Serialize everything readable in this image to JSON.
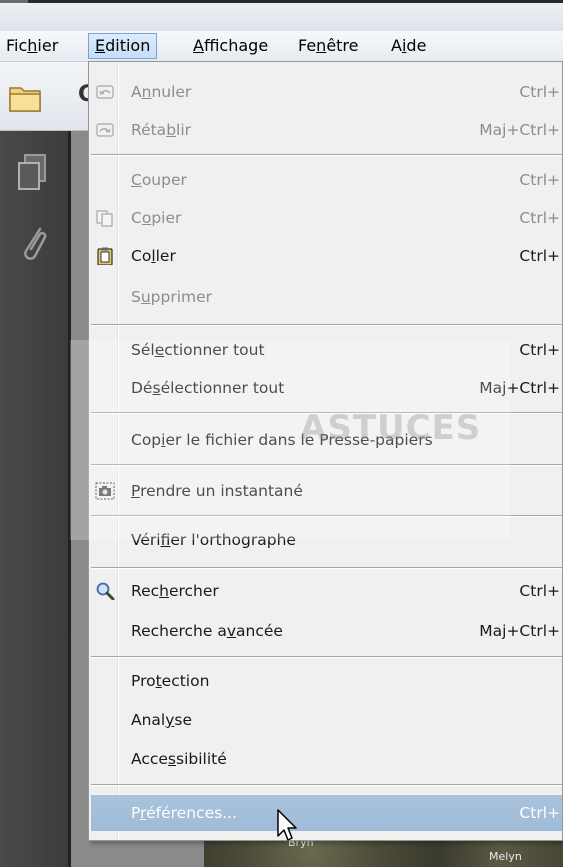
{
  "menubar": {
    "items": [
      {
        "pre": "Fic",
        "mn": "h",
        "post": "ier"
      },
      {
        "pre": "",
        "mn": "E",
        "post": "dition"
      },
      {
        "pre": "",
        "mn": "A",
        "post": "ffichage"
      },
      {
        "pre": "Fe",
        "mn": "n",
        "post": "être"
      },
      {
        "pre": "A",
        "mn": "i",
        "post": "de"
      }
    ]
  },
  "toolbar": {
    "cut_text": "C"
  },
  "menu": {
    "undo": {
      "pre": "A",
      "mn": "n",
      "post": "nuler",
      "shortcut": "Ctrl+"
    },
    "redo": {
      "pre": "Réta",
      "mn": "b",
      "post": "lir",
      "shortcut": "Maj+Ctrl+"
    },
    "cut": {
      "pre": "",
      "mn": "C",
      "post": "ouper",
      "shortcut": "Ctrl+"
    },
    "copy": {
      "pre": "C",
      "mn": "o",
      "post": "pier",
      "shortcut": "Ctrl+"
    },
    "paste": {
      "pre": "Co",
      "mn": "l",
      "post": "ler",
      "shortcut": "Ctrl+"
    },
    "delete": {
      "pre": "S",
      "mn": "u",
      "post": "pprimer"
    },
    "select_all": {
      "pre": "Sél",
      "mn": "e",
      "post": "ctionner tout",
      "shortcut": "Ctrl+"
    },
    "deselect_all": {
      "pre": "Dé",
      "mn": "s",
      "post": "électionner tout",
      "shortcut": "Maj+Ctrl+"
    },
    "copy_file": {
      "pre": "Cop",
      "mn": "i",
      "post": "er le fichier dans le Presse-papiers"
    },
    "snapshot": {
      "pre": "",
      "mn": "P",
      "post": "rendre un instantané"
    },
    "spellcheck": {
      "pre": "Véri",
      "mn": "f",
      "post": "ier l'orthographe"
    },
    "search": {
      "pre": "Rec",
      "mn": "h",
      "post": "ercher",
      "shortcut": "Ctrl+"
    },
    "advanced_search": {
      "pre": "Recherche a",
      "mn": "v",
      "post": "ancée",
      "shortcut": "Maj+Ctrl+"
    },
    "protection": {
      "pre": "Pro",
      "mn": "t",
      "post": "ection"
    },
    "analysis": {
      "pre": "Anal",
      "mn": "y",
      "post": "se"
    },
    "accessibility": {
      "pre": "Acce",
      "mn": "s",
      "post": "sibilité"
    },
    "preferences": {
      "pre": "P",
      "mn": "r",
      "post": "éférences...",
      "shortcut": "Ctrl+"
    }
  },
  "watermark": {
    "text": "ASTUCES"
  },
  "map": {
    "label1": "Bryn",
    "label2": "Melyn"
  }
}
